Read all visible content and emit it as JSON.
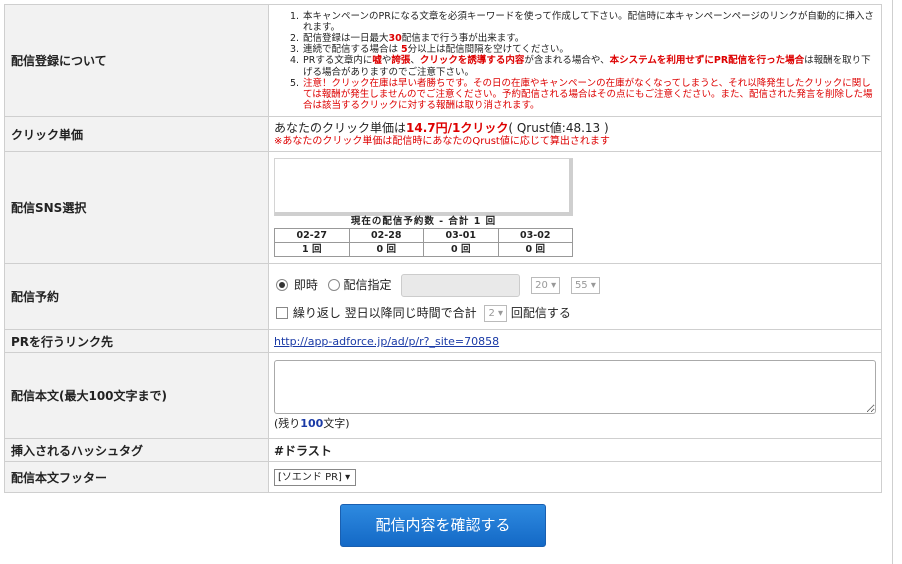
{
  "rows": {
    "about": {
      "label": "配信登録について",
      "notes": [
        {
          "num": "1.",
          "text": "本キャンペーンのPRになる文章を必須キーワードを使って作成して下さい。配信時に本キャンペーンページのリンクが自動的に挿入されます。"
        },
        {
          "num": "2.",
          "pre": "配信登録は一日最大",
          "hl": "30",
          "post": "配信まで行う事が出来ます。"
        },
        {
          "num": "3.",
          "pre": "連続で配信する場合は ",
          "hl": "5",
          "post": "分以上は配信間隔を空けてください。"
        },
        {
          "num": "4.",
          "p1": "PRする文章内に",
          "h1": "嘘",
          "p2": "や",
          "h2": "誇張",
          "p3": "、",
          "h3": "クリックを誘導する内容",
          "p4": "が含まれる場合や、",
          "h4": "本システムを利用せずにPR配信を行った場合",
          "p5": "は報酬を取り下げる場合がありますのでご注意下さい。"
        },
        {
          "num": "5.",
          "text": "注意！クリック在庫は早い者勝ちです。その日の在庫やキャンペーンの在庫がなくなってしまうと、それ以降発生したクリックに関しては報酬が発生しませんのでご注意ください。予約配信される場合はその点にもご注意ください。また、配信された発言を削除した場合は該当するクリックに対する報酬は取り消されます。"
        }
      ]
    },
    "price": {
      "label": "クリック単価",
      "pre": "あなたのクリック単価は",
      "value": "14.7円/1クリック",
      "post": "( Qrust値:48.13 )",
      "note": "※あなたのクリック単価は配信時にあなたのQrust値に応じて算出されます"
    },
    "sns": {
      "label": "配信SNS選択",
      "summary": "現在の配信予約数 - 合計 1 回",
      "dates": [
        "02-27",
        "02-28",
        "03-01",
        "03-02"
      ],
      "counts": [
        "1 回",
        "0 回",
        "0 回",
        "0 回"
      ]
    },
    "schedule": {
      "label": "配信予約",
      "now_label": "即時",
      "specify_label": "配信指定",
      "hour": "20",
      "minute": "55",
      "repeat_label": "繰り返し 翌日以降同じ時間で合計",
      "repeat_count": "2",
      "repeat_suffix": "回配信する"
    },
    "link": {
      "label": "PRを行うリンク先",
      "url": "http://app-adforce.jp/ad/p/r?_site=70858"
    },
    "body": {
      "label": "配信本文(最大100文字まで)",
      "remain_pre": "(残り",
      "remain_num": "100",
      "remain_post": "文字)"
    },
    "hashtag": {
      "label": "挿入されるハッシュタグ",
      "value": "#ドラスト"
    },
    "footer": {
      "label": "配信本文フッター",
      "selected": "[ソエンド PR]"
    }
  },
  "submit_label": "配信内容を確認する"
}
